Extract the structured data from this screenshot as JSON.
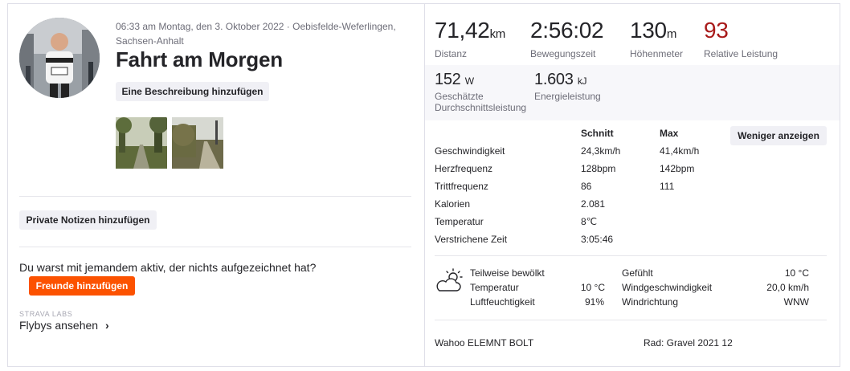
{
  "activity": {
    "meta": "06:33 am Montag, den 3. Oktober 2022 · Oebisfelde-Weferlingen, Sachsen-Anhalt",
    "title": "Fahrt am Morgen",
    "add_description": "Eine Beschreibung hinzufügen",
    "private_notes": "Private Notizen hinzufügen",
    "with_someone": "Du warst mit jemandem aktiv, der nichts aufgezeichnet hat?",
    "add_friends": "Freunde hinzufügen",
    "labs": "STRAVA LABS",
    "flybys": "Flybys ansehen",
    "flybys_chevron": "›"
  },
  "stats": [
    {
      "value": "71,42",
      "unit": "km",
      "label": "Distanz"
    },
    {
      "value": "2:56:02",
      "unit": "",
      "label": "Bewegungszeit"
    },
    {
      "value": "130",
      "unit": "m",
      "label": "Höhenmeter"
    },
    {
      "value": "93",
      "unit": "",
      "label": "Relative Leistung"
    }
  ],
  "stats2": [
    {
      "value": "152",
      "unit": "W",
      "label": "Geschätzte Durchschnittsleistung"
    },
    {
      "value": "1.603",
      "unit": "kJ",
      "label": "Energieleistung"
    }
  ],
  "table": {
    "col_avg": "Schnitt",
    "col_max": "Max",
    "less_button": "Weniger anzeigen",
    "rows": [
      {
        "label": "Geschwindigkeit",
        "avg": "24,3km/h",
        "max": "41,4km/h"
      },
      {
        "label": "Herzfrequenz",
        "avg": "128bpm",
        "max": "142bpm"
      },
      {
        "label": "Trittfrequenz",
        "avg": "86",
        "max": "111"
      },
      {
        "label": "Kalorien",
        "avg": "2.081",
        "max": ""
      },
      {
        "label": "Temperatur",
        "avg": "8℃",
        "max": ""
      },
      {
        "label": "Verstrichene Zeit",
        "avg": "3:05:46",
        "max": ""
      }
    ]
  },
  "weather": {
    "condition": "Teilweise bewölkt",
    "temp_label": "Temperatur",
    "temp_value": "10 °C",
    "humidity_label": "Luftfeuchtigkeit",
    "humidity_value": "91%",
    "feels_label": "Gefühlt",
    "feels_value": "10 °C",
    "wind_speed_label": "Windgeschwindigkeit",
    "wind_speed_value": "20,0 km/h",
    "wind_dir_label": "Windrichtung",
    "wind_dir_value": "WNW",
    "icon": "partly-cloudy-icon"
  },
  "gear": {
    "device": "Wahoo ELEMNT BOLT",
    "bike": "Rad: Gravel 2021 12"
  },
  "colors": {
    "accent": "#fc5200",
    "relative_effort": "#a81a1a"
  }
}
